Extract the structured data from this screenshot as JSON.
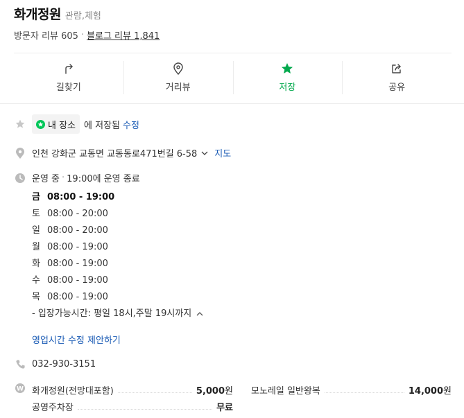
{
  "place": {
    "name": "화개정원",
    "category": "관람,체험"
  },
  "reviews": {
    "visitor": "방문자 리뷰 605",
    "separator": "·",
    "blog": "블로그 리뷰 1,841"
  },
  "actions": [
    {
      "label": "길찾기",
      "icon": "directions-icon"
    },
    {
      "label": "거리뷰",
      "icon": "map-pin-icon"
    },
    {
      "label": "저장",
      "icon": "star-icon",
      "active": true
    },
    {
      "label": "공유",
      "icon": "share-icon"
    }
  ],
  "saved": {
    "chip_label": "내 장소",
    "text": "에 저장됨",
    "edit": "수정"
  },
  "address": {
    "text": "인천 강화군 교동면 교동동로471번길 6-58",
    "map_link": "지도"
  },
  "hours_status": {
    "status": "운영 중",
    "separator": "·",
    "detail": "19:00에 운영 종료"
  },
  "hours": [
    {
      "day": "금",
      "time": "08:00 - 19:00",
      "today": true
    },
    {
      "day": "토",
      "time": "08:00 - 20:00"
    },
    {
      "day": "일",
      "time": "08:00 - 20:00"
    },
    {
      "day": "월",
      "time": "08:00 - 19:00"
    },
    {
      "day": "화",
      "time": "08:00 - 19:00"
    },
    {
      "day": "수",
      "time": "08:00 - 19:00"
    },
    {
      "day": "목",
      "time": "08:00 - 19:00"
    }
  ],
  "entry_note": "- 입장가능시간: 평일 18시,주말 19시까지",
  "suggest_edit": "영업시간 수정 제안하기",
  "phone": "032-930-3151",
  "prices": [
    {
      "name": "화개정원(전망대포함)",
      "value": "5,000",
      "unit": "원"
    },
    {
      "name": "모노레일 일반왕복",
      "value": "14,000",
      "unit": "원"
    },
    {
      "name": "공영주차장",
      "value": "무료",
      "unit": ""
    }
  ],
  "colors": {
    "accent": "#03c75a",
    "link": "#1a5bb5",
    "icon_gray": "#bbbbbb"
  }
}
